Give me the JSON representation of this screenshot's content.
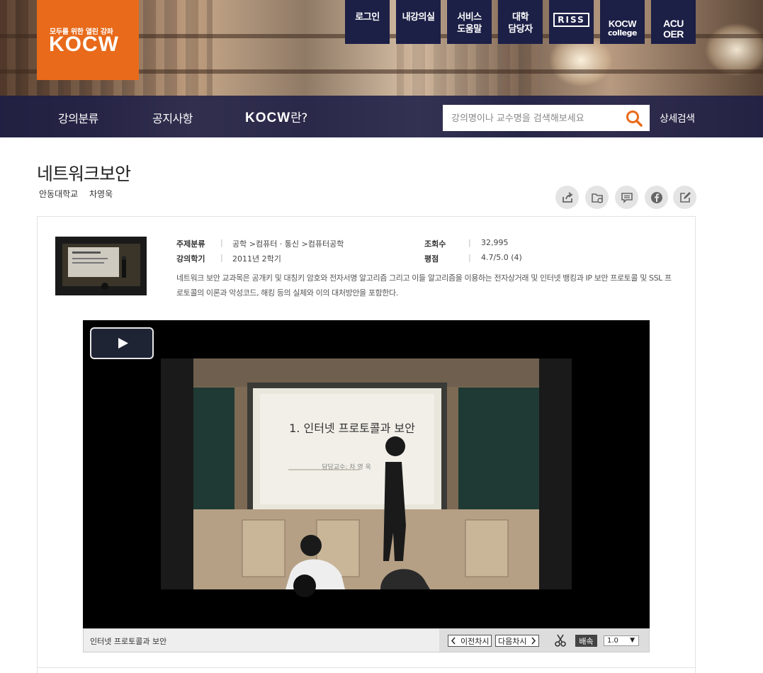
{
  "header": {
    "logo": {
      "tagline": "모두를 위한 열린 강좌",
      "wordmark": "KOCW"
    },
    "top_buttons": {
      "login": "로그인",
      "my_room": "내강의실",
      "help_1": "서비스",
      "help_2": "도움말",
      "univ_1": "대학",
      "univ_2": "담당자",
      "riss": "RISS",
      "college_1": "KOCW",
      "college_2": "college",
      "acu_1": "ACU",
      "acu_2": "OER"
    },
    "nav": {
      "category": "강의분류",
      "notice": "공지사항",
      "about_word": "KOCW",
      "about_suffix": "란?"
    },
    "search": {
      "placeholder": "강의명이나 교수명을 검색해보세요",
      "advanced": "상세검색"
    }
  },
  "course": {
    "title": "네트워크보안",
    "university": "안동대학교",
    "professor": "차영욱",
    "info": {
      "subject_label": "주제분류",
      "subject_value": "공학 >컴퓨터 · 통신 >컴퓨터공학",
      "semester_label": "강의학기",
      "semester_value": "2011년 2학기",
      "views_label": "조회수",
      "views_value": "32,995",
      "rating_label": "평점",
      "rating_value": "4.7/5.0 (4)",
      "separator": "|"
    },
    "description": "네트워크 보안 교과목은 공개키 및 대칭키 암호와 전자서명 알고리즘 그리고 이들 알고리즘을 이용하는 전자상거래 및 인터넷 뱅킹과 IP 보안 프로토콜 및 SSL 프로토콜의 이론과 악성코드, 해킹 등의 실체와 이의 대처방안을 포함한다."
  },
  "share_icons": [
    "share-icon",
    "folder-add-icon",
    "comment-icon",
    "facebook-icon",
    "edit-icon"
  ],
  "player": {
    "slide_title": "1. 인터넷 프로토콜과 보안",
    "slide_sub": "담당교수: 차 영 욱",
    "lecture_name": "인터넷 프로토콜과 보안",
    "prev": "이전차시",
    "next": "다음차시",
    "speed_label": "배속",
    "speed_value": "1.0"
  },
  "colors": {
    "brand_orange": "#e86a1a",
    "navy": "#1c1f46",
    "search_orange": "#e86a1a"
  }
}
